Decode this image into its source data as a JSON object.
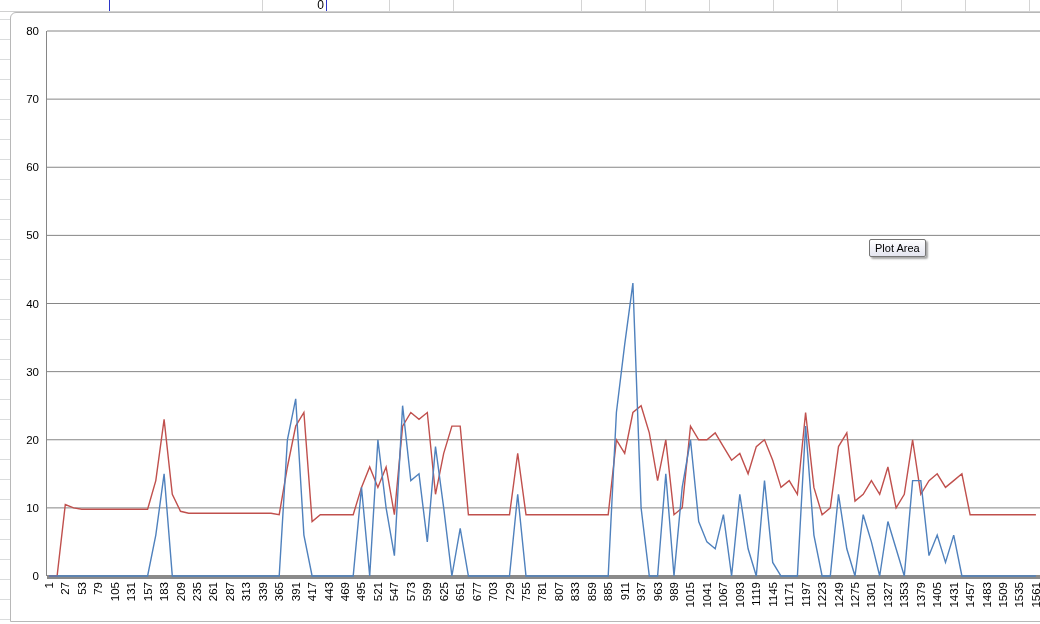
{
  "spreadsheet": {
    "cell_value": "0"
  },
  "chart": {
    "chart_data": {
      "type": "line",
      "x": [
        1,
        14,
        27,
        40,
        53,
        66,
        79,
        92,
        105,
        118,
        131,
        144,
        157,
        170,
        183,
        196,
        209,
        222,
        235,
        248,
        261,
        274,
        287,
        300,
        313,
        326,
        339,
        352,
        365,
        378,
        391,
        404,
        417,
        430,
        443,
        456,
        469,
        482,
        495,
        508,
        521,
        534,
        547,
        560,
        573,
        586,
        599,
        612,
        625,
        638,
        651,
        664,
        677,
        690,
        703,
        716,
        729,
        742,
        755,
        768,
        781,
        794,
        807,
        820,
        833,
        846,
        859,
        872,
        885,
        898,
        911,
        924,
        937,
        950,
        963,
        976,
        989,
        1002,
        1015,
        1028,
        1041,
        1054,
        1067,
        1080,
        1093,
        1106,
        1119,
        1132,
        1145,
        1158,
        1171,
        1184,
        1197,
        1210,
        1223,
        1236,
        1249,
        1262,
        1275,
        1288,
        1301,
        1314,
        1327,
        1340,
        1353,
        1366,
        1379,
        1392,
        1405,
        1418,
        1431,
        1444,
        1457,
        1470,
        1483,
        1496,
        1509,
        1522,
        1535,
        1548,
        1561
      ],
      "xticks": [
        1,
        27,
        53,
        79,
        105,
        131,
        157,
        183,
        209,
        235,
        261,
        287,
        313,
        339,
        365,
        391,
        417,
        443,
        469,
        495,
        521,
        547,
        573,
        599,
        625,
        651,
        677,
        703,
        729,
        755,
        781,
        807,
        833,
        859,
        885,
        911,
        937,
        963,
        989,
        1015,
        1041,
        1067,
        1093,
        1119,
        1145,
        1171,
        1197,
        1223,
        1249,
        1275,
        1301,
        1327,
        1353,
        1379,
        1405,
        1431,
        1457,
        1483,
        1509,
        1535,
        1561
      ],
      "xlim": [
        -2,
        1569
      ],
      "ylim": [
        0,
        80
      ],
      "grid": true,
      "yticks": [
        0,
        10,
        20,
        30,
        40,
        50,
        60,
        70,
        80
      ],
      "series": [
        {
          "color": "#c0504d",
          "values": [
            0,
            0,
            10.5,
            10,
            9.8,
            9.8,
            9.8,
            9.8,
            9.8,
            9.8,
            9.8,
            9.8,
            9.8,
            14,
            23,
            12,
            9.5,
            9.2,
            9.2,
            9.2,
            9.2,
            9.2,
            9.2,
            9.2,
            9.2,
            9.2,
            9.2,
            9.2,
            9,
            16,
            22,
            24,
            8,
            9,
            9,
            9,
            9,
            9,
            13,
            16,
            13,
            16,
            9,
            22,
            24,
            23,
            24,
            12,
            18,
            22,
            22,
            9,
            9,
            9,
            9,
            9,
            9,
            18,
            9,
            9,
            9,
            9,
            9,
            9,
            9,
            9,
            9,
            9,
            9,
            20,
            18,
            24,
            25,
            21,
            14,
            20,
            9,
            10,
            22,
            20,
            20,
            21,
            19,
            17,
            18,
            15,
            19,
            20,
            17,
            13,
            14,
            12,
            24,
            13,
            9,
            10,
            19,
            21,
            11,
            12,
            14,
            12,
            16,
            10,
            12,
            20,
            12,
            14,
            15,
            13,
            14,
            15,
            9,
            9,
            9,
            9,
            9,
            9,
            9,
            9,
            9
          ]
        },
        {
          "color": "#4f81bd",
          "values": [
            0,
            0,
            0,
            0,
            0,
            0,
            0,
            0,
            0,
            0,
            0,
            0,
            0,
            6,
            15,
            0,
            0,
            0,
            0,
            0,
            0,
            0,
            0,
            0,
            0,
            0,
            0,
            0,
            0,
            20,
            26,
            6,
            0,
            0,
            0,
            0,
            0,
            0,
            13,
            0,
            20,
            10,
            3,
            25,
            14,
            15,
            5,
            19,
            10,
            0,
            7,
            0,
            0,
            0,
            0,
            0,
            0,
            12,
            0,
            0,
            0,
            0,
            0,
            0,
            0,
            0,
            0,
            0,
            0,
            24,
            34,
            43,
            10,
            0,
            0,
            15,
            0,
            13,
            20,
            8,
            5,
            4,
            9,
            0,
            12,
            4,
            0,
            14,
            2,
            0,
            0,
            0,
            22,
            6,
            0,
            0,
            12,
            4,
            0,
            9,
            5,
            0,
            8,
            4,
            0,
            14,
            14,
            3,
            6,
            2,
            6,
            0,
            0,
            0,
            0,
            0,
            0,
            0,
            0,
            0,
            0
          ]
        }
      ]
    }
  },
  "tooltip": {
    "text": "Plot Area"
  }
}
